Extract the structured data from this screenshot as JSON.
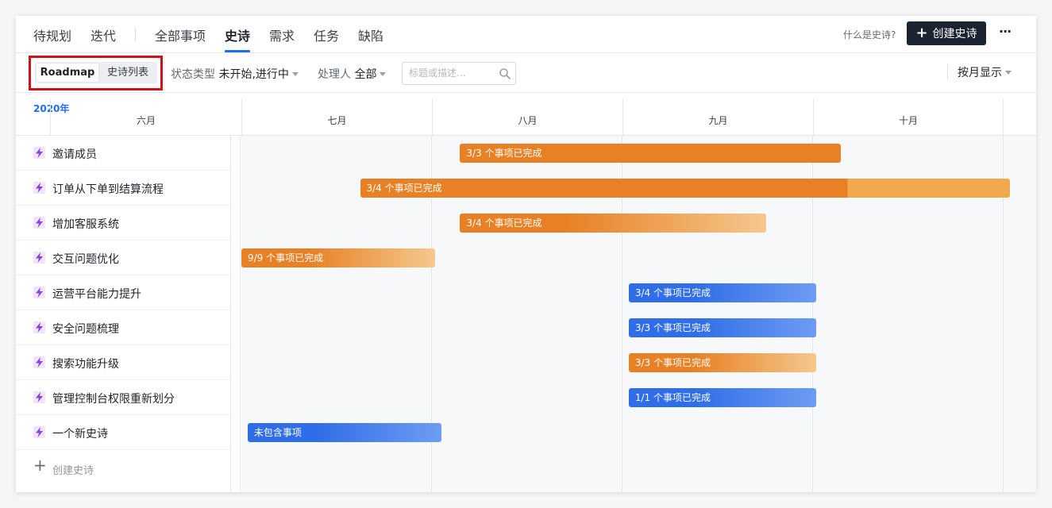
{
  "nav": {
    "tabs": [
      "待规划",
      "迭代",
      "全部事项",
      "史诗",
      "需求",
      "任务",
      "缺陷"
    ],
    "active_tab": "史诗",
    "what_is_link": "什么是史诗?",
    "create_button": "创建史诗",
    "more": "···"
  },
  "filters": {
    "view_options": [
      "Roadmap",
      "史诗列表"
    ],
    "active_view": "Roadmap",
    "status_label": "状态类型",
    "status_value": "未开始,进行中",
    "assignee_label": "处理人",
    "assignee_value": "全部",
    "search_placeholder": "标题或描述...",
    "display_mode": "按月显示"
  },
  "timeline": {
    "year": "2020年",
    "months": [
      "六月",
      "七月",
      "八月",
      "九月",
      "十月"
    ]
  },
  "epics": [
    {
      "name": "邀请成员",
      "bar_label": "3/3 个事项已完成",
      "color": "orange",
      "start": "2020-08-05",
      "end": "2020-10-05",
      "progress": 1.0
    },
    {
      "name": "订单从下单到结算流程",
      "bar_label": "3/4 个事项已完成",
      "color": "orange",
      "start": "2020-07-20",
      "end": "2020-11-01",
      "progress": 0.75
    },
    {
      "name": "增加客服系统",
      "bar_label": "3/4 个事项已完成",
      "color": "orange-light",
      "start": "2020-08-05",
      "end": "2020-09-23",
      "progress": 0.0
    },
    {
      "name": "交互问题优化",
      "bar_label": "9/9 个事项已完成",
      "color": "orange-light",
      "start": "2020-07-01",
      "end": "2020-08-01",
      "progress": 0.0
    },
    {
      "name": "运营平台能力提升",
      "bar_label": "3/4 个事项已完成",
      "color": "blue",
      "start": "2020-09-01",
      "end": "2020-10-01",
      "progress": 0.0
    },
    {
      "name": "安全问题梳理",
      "bar_label": "3/3 个事项已完成",
      "color": "blue",
      "start": "2020-09-01",
      "end": "2020-10-01",
      "progress": 0.0
    },
    {
      "name": "搜索功能升级",
      "bar_label": "3/3 个事项已完成",
      "color": "orange-light",
      "start": "2020-09-01",
      "end": "2020-10-01",
      "progress": 0.0
    },
    {
      "name": "管理控制台权限重新划分",
      "bar_label": "1/1 个事项已完成",
      "color": "blue",
      "start": "2020-09-01",
      "end": "2020-10-01",
      "progress": 0.0
    },
    {
      "name": "一个新史诗",
      "bar_label": "未包含事项",
      "color": "blue",
      "start": "2020-07-02",
      "end": "2020-08-02",
      "progress": 0.0
    }
  ],
  "add_epic": "创建史诗",
  "colors": {
    "orange": "#e88125",
    "orange_light": "#f0a94e",
    "blue": "#2f6ee8",
    "accent": "#1f6fff",
    "highlight": "#d0121b"
  },
  "icons": {
    "epic": "lightning-icon",
    "search": "search-icon",
    "add": "plus-icon"
  }
}
